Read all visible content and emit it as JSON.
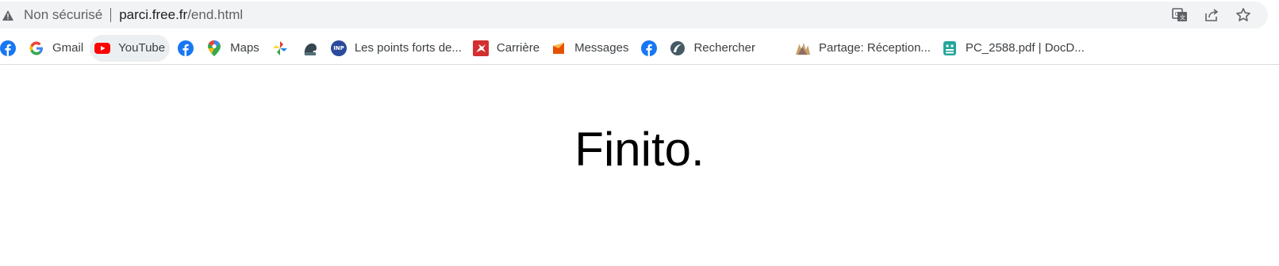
{
  "omnibox": {
    "security_label": "Non sécurisé",
    "url_host": "parci.free.fr",
    "url_path": "/end.html"
  },
  "bookmarks": [
    {
      "label": "",
      "icon": "facebook-icon"
    },
    {
      "label": "Gmail",
      "icon": "google-icon"
    },
    {
      "label": "YouTube",
      "icon": "youtube-icon"
    },
    {
      "label": "",
      "icon": "facebook-icon"
    },
    {
      "label": "Maps",
      "icon": "maps-pin-icon"
    },
    {
      "label": "",
      "icon": "pinwheel-icon"
    },
    {
      "label": "",
      "icon": "bison-icon"
    },
    {
      "label": "Les points forts de...",
      "icon": "inp-logo-icon"
    },
    {
      "label": "Carrière",
      "icon": "kangaroo-icon"
    },
    {
      "label": "Messages",
      "icon": "messages-icon"
    },
    {
      "label": "",
      "icon": "facebook-icon"
    },
    {
      "label": "Rechercher",
      "icon": "search-logo-icon"
    },
    {
      "label": "Partage: Réception...",
      "icon": "partage-icon"
    },
    {
      "label": "PC_2588.pdf | DocD...",
      "icon": "docdroid-icon"
    }
  ],
  "page": {
    "heading": "Finito."
  },
  "colors": {
    "omnibox_bg": "#f1f3f4",
    "facebook": "#1877f2",
    "youtube": "#ff0000"
  }
}
